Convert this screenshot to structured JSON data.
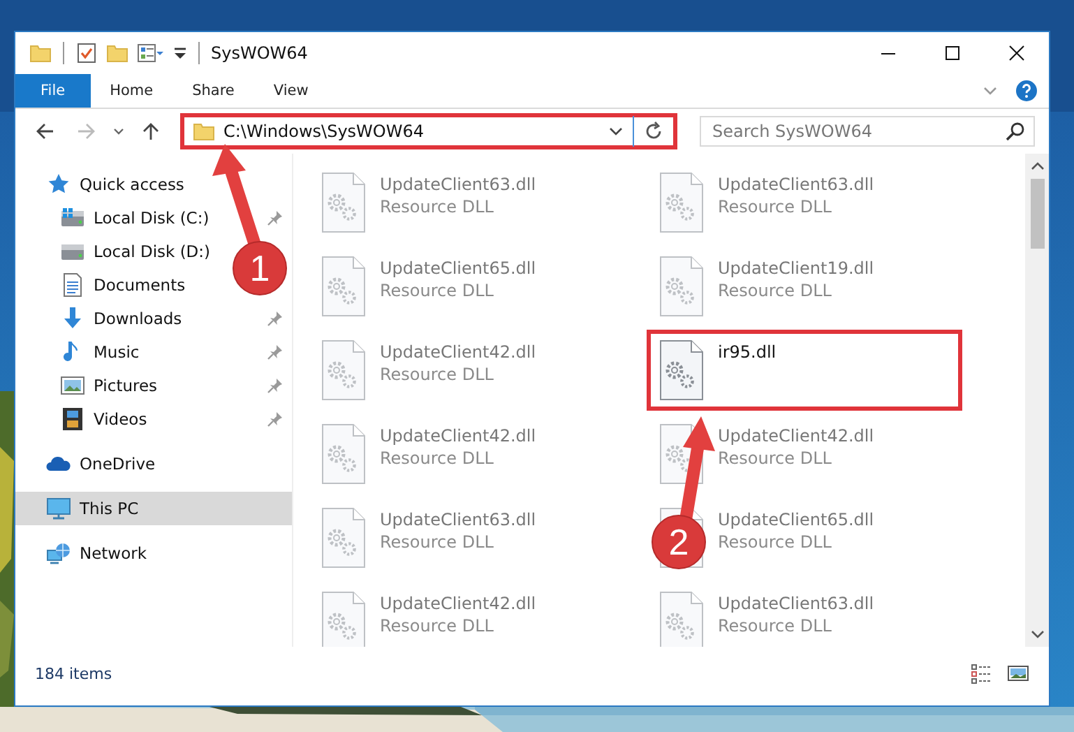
{
  "window": {
    "title": "SysWOW64"
  },
  "ribbon_tabs": [
    {
      "label": "File",
      "kind": "file"
    },
    {
      "label": "Home",
      "kind": "tab"
    },
    {
      "label": "Share",
      "kind": "tab"
    },
    {
      "label": "View",
      "kind": "tab"
    }
  ],
  "address": {
    "path": "C:\\Windows\\SysWOW64",
    "highlighted": true
  },
  "search": {
    "placeholder": "Search SysWOW64"
  },
  "sidebar": {
    "items": [
      {
        "label": "Quick access",
        "kind": "star",
        "selected": false,
        "pinned": false,
        "children": [
          {
            "label": "Local Disk (C:)",
            "kind": "disk-c",
            "selected": false,
            "pinned": true
          },
          {
            "label": "Local Disk (D:)",
            "kind": "disk",
            "selected": false,
            "pinned": false
          },
          {
            "label": "Documents",
            "kind": "documents",
            "selected": false,
            "pinned": false
          },
          {
            "label": "Downloads",
            "kind": "downloads",
            "selected": false,
            "pinned": true
          },
          {
            "label": "Music",
            "kind": "music",
            "selected": false,
            "pinned": true
          },
          {
            "label": "Pictures",
            "kind": "pictures",
            "selected": false,
            "pinned": true
          },
          {
            "label": "Videos",
            "kind": "videos",
            "selected": false,
            "pinned": true
          }
        ]
      },
      {
        "label": "OneDrive",
        "kind": "cloud",
        "selected": false,
        "pinned": false
      },
      {
        "label": "This PC",
        "kind": "pc",
        "selected": true,
        "pinned": false
      },
      {
        "label": "Network",
        "kind": "network",
        "selected": false,
        "pinned": false
      }
    ]
  },
  "files": [
    {
      "name": "UpdateClient63.dll",
      "type": "Resource DLL",
      "blurred": true,
      "highlighted": false
    },
    {
      "name": "UpdateClient63.dll",
      "type": "Resource DLL",
      "blurred": true,
      "highlighted": false
    },
    {
      "name": "UpdateClient65.dll",
      "type": "Resource DLL",
      "blurred": true,
      "highlighted": false
    },
    {
      "name": "UpdateClient19.dll",
      "type": "Resource DLL",
      "blurred": true,
      "highlighted": false
    },
    {
      "name": "UpdateClient42.dll",
      "type": "Resource DLL",
      "blurred": true,
      "highlighted": false
    },
    {
      "name": "ir95.dll",
      "blurred": false,
      "highlighted": true
    },
    {
      "name": "UpdateClient42.dll",
      "type": "Resource DLL",
      "blurred": true,
      "highlighted": false
    },
    {
      "name": "UpdateClient42.dll",
      "type": "Resource DLL",
      "blurred": true,
      "highlighted": false
    },
    {
      "name": "UpdateClient63.dll",
      "type": "Resource DLL",
      "blurred": true,
      "highlighted": false
    },
    {
      "name": "UpdateClient65.dll",
      "type": "Resource DLL",
      "blurred": true,
      "highlighted": false
    },
    {
      "name": "UpdateClient42.dll",
      "type": "Resource DLL",
      "blurred": true,
      "highlighted": false
    },
    {
      "name": "UpdateClient63.dll",
      "type": "Resource DLL",
      "blurred": true,
      "highlighted": false
    }
  ],
  "status_bar": {
    "item_count": "184 items"
  },
  "annotations": [
    {
      "label": "1"
    },
    {
      "label": "2"
    }
  ]
}
